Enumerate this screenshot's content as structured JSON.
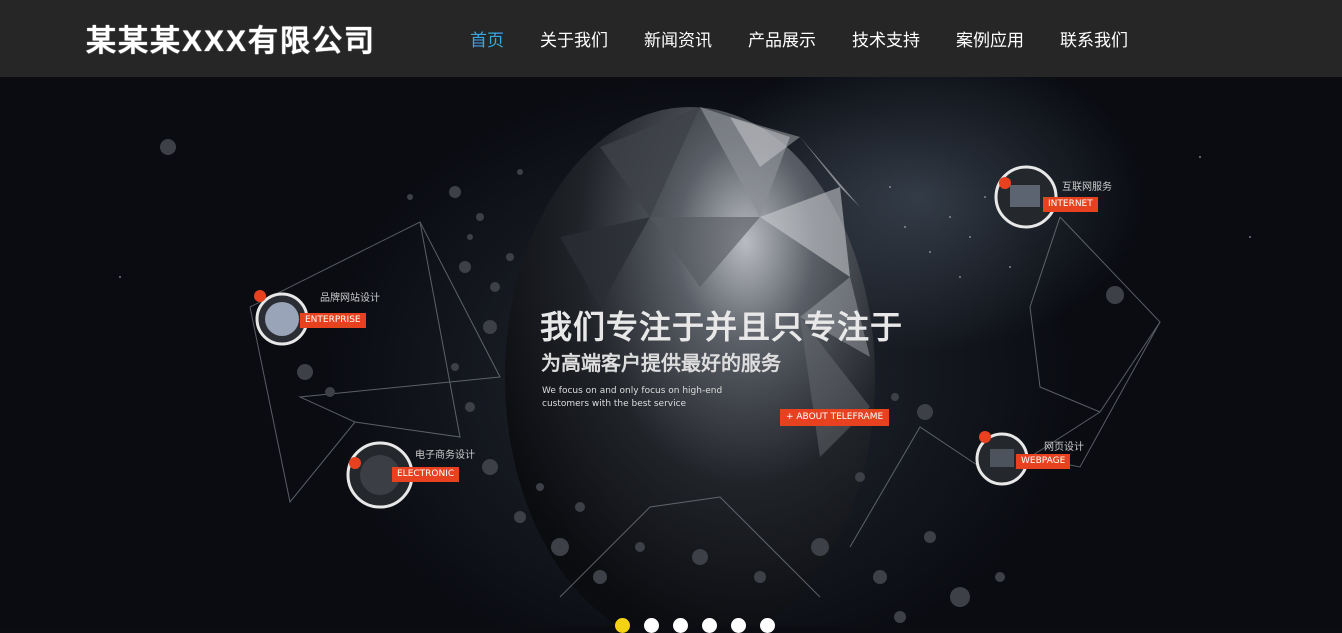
{
  "header": {
    "logo": "某某某XXX有限公司",
    "nav": [
      "首页",
      "关于我们",
      "新闻资讯",
      "产品展示",
      "技术支持",
      "案例应用",
      "联系我们"
    ],
    "active_nav": "首页"
  },
  "banner": {
    "headline": "我们专注于并且只专注于",
    "subline": "为高端客户提供最好的服务",
    "en_desc": "We focus on and only focus on high-end customers with the best service",
    "about_button": "+ ABOUT TELEFRAME",
    "services": [
      {
        "cn": "品牌网站设计",
        "en": "ENTERPRISE"
      },
      {
        "cn": "电子商务设计",
        "en": "ELECTRONIC"
      },
      {
        "cn": "互联网服务",
        "en": "INTERNET"
      },
      {
        "cn": "网页设计",
        "en": "WEBPAGE"
      }
    ]
  },
  "carousel": {
    "slide_count": 6,
    "active_index": 0
  },
  "colors": {
    "header_bg": "#262626",
    "active_link": "#3da6e2",
    "tag_red": "#e8411f",
    "active_dot": "#f3d313"
  }
}
